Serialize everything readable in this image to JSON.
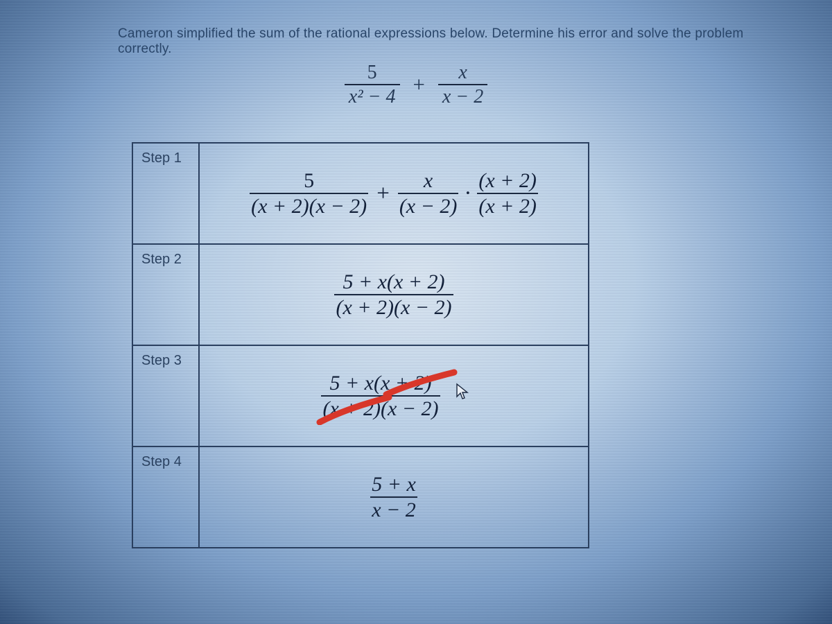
{
  "prompt": "Cameron simplified the sum of the rational expressions below. Determine his error and solve the problem correctly.",
  "origExpr": {
    "left_num": "5",
    "left_den": "x² − 4",
    "plus": "+",
    "right_num": "x",
    "right_den": "x − 2"
  },
  "steps": [
    {
      "label": "Step 1",
      "expr": {
        "a_num": "5",
        "a_den": "(x + 2)(x − 2)",
        "plus": "+",
        "b_num": "x",
        "b_den": "(x − 2)",
        "dot": "·",
        "c_num": "(x + 2)",
        "c_den": "(x + 2)"
      }
    },
    {
      "label": "Step 2",
      "expr": {
        "num": "5 + x(x + 2)",
        "den": "(x + 2)(x − 2)"
      }
    },
    {
      "label": "Step 3",
      "expr": {
        "num": "5 + x(x + 2)",
        "den": "(x + 2)(x − 2)"
      },
      "annotation": "red-slash-cancel"
    },
    {
      "label": "Step 4",
      "expr": {
        "num": "5 + x",
        "den": "x − 2"
      }
    }
  ],
  "colors": {
    "text": "#1a2840",
    "border": "#2a3f5f",
    "annotation": "#d8372a"
  }
}
